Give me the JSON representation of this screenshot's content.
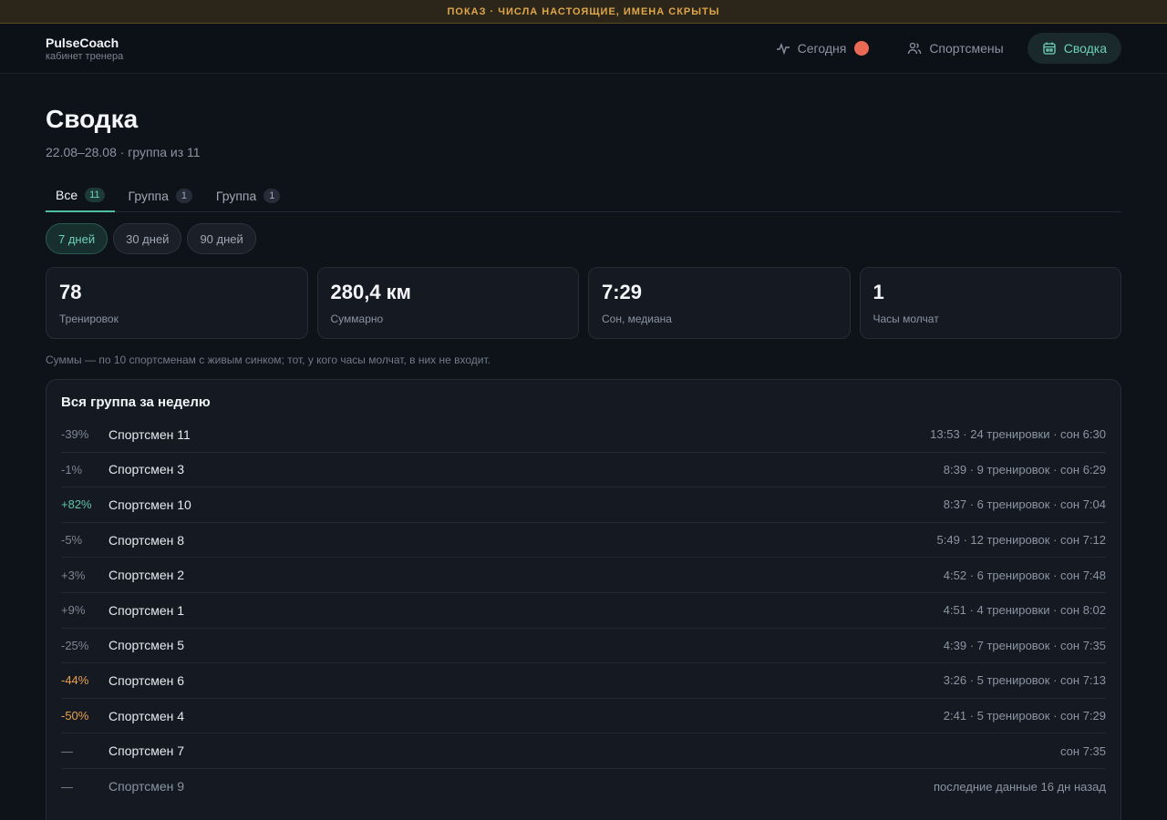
{
  "banner": "ПОКАЗ · ЧИСЛА НАСТОЯЩИЕ, ИМЕНА СКРЫТЫ",
  "brand": {
    "name": "PulseCoach",
    "sub": "кабинет тренера"
  },
  "nav": {
    "today": "Сегодня",
    "athletes": "Спортсмены",
    "summary": "Сводка"
  },
  "page": {
    "title": "Сводка",
    "subtitle": "22.08–28.08 · группа из 11"
  },
  "tabs": [
    {
      "label": "Все",
      "count": "11"
    },
    {
      "label": "Группа",
      "count": "1"
    },
    {
      "label": "Группа",
      "count": "1"
    }
  ],
  "periods": [
    "7 дней",
    "30 дней",
    "90 дней"
  ],
  "stats": [
    {
      "value": "78",
      "label": "Тренировок"
    },
    {
      "value": "280,4 км",
      "label": "Суммарно"
    },
    {
      "value": "7:29",
      "label": "Сон, медиана"
    },
    {
      "value": "1",
      "label": "Часы молчат"
    }
  ],
  "note": "Суммы — по 10 спортсменам с живым синком; тот, у кого часы молчат, в них не входит.",
  "panel": {
    "title": "Вся группа за неделю",
    "rows": [
      {
        "delta": "-39%",
        "name": "Спортсмен 11",
        "meta": "13:53 · 24 тренировки · сон 6:30"
      },
      {
        "delta": "-1%",
        "name": "Спортсмен 3",
        "meta": "8:39 · 9 тренировок · сон 6:29"
      },
      {
        "delta": "+82%",
        "name": "Спортсмен 10",
        "meta": "8:37 · 6 тренировок · сон 7:04"
      },
      {
        "delta": "-5%",
        "name": "Спортсмен 8",
        "meta": "5:49 · 12 тренировок · сон 7:12"
      },
      {
        "delta": "+3%",
        "name": "Спортсмен 2",
        "meta": "4:52 · 6 тренировок · сон 7:48"
      },
      {
        "delta": "+9%",
        "name": "Спортсмен 1",
        "meta": "4:51 · 4 тренировки · сон 8:02"
      },
      {
        "delta": "-25%",
        "name": "Спортсмен 5",
        "meta": "4:39 · 7 тренировок · сон 7:35"
      },
      {
        "delta": "-44%",
        "name": "Спортсмен 6",
        "meta": "3:26 · 5 тренировок · сон 7:13"
      },
      {
        "delta": "-50%",
        "name": "Спортсмен 4",
        "meta": "2:41 · 5 тренировок · сон 7:29"
      },
      {
        "delta": "—",
        "name": "Спортсмен 7",
        "meta": "сон 7:35"
      },
      {
        "delta": "—",
        "name": "Спортсмен 9",
        "meta": "последние данные 16 дн назад"
      }
    ]
  },
  "colors": {
    "accent": "#6fd0b9",
    "warn": "#e8a050",
    "alert_dot": "#ec6a55"
  }
}
